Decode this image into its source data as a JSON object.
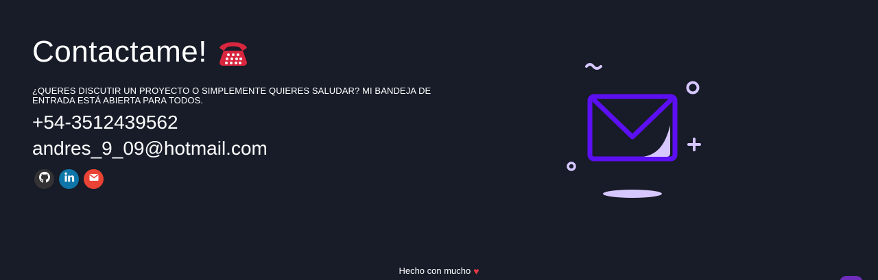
{
  "contact": {
    "title": "Contactame!",
    "title_icon": "telephone-icon",
    "subtitle": "¿QUERES DISCUTIR UN PROYECTO O SIMPLEMENTE QUIERES SALUDAR? MI BANDEJA DE ENTRADA ESTÁ ABIERTA PARA TODOS.",
    "phone": "+54-3512439562",
    "email": "andres_9_09@hotmail.com"
  },
  "socials": [
    {
      "name": "github-icon",
      "color": "#333333"
    },
    {
      "name": "linkedin-icon",
      "color": "#0e76a8"
    },
    {
      "name": "mail-icon",
      "color": "#ea4335"
    }
  ],
  "illustration": {
    "name": "envelope-illustration",
    "accent": "#5c0ff2",
    "light": "#d7c7ff"
  },
  "footer": {
    "text": "Hecho con mucho",
    "icon": "heart-icon"
  },
  "colors": {
    "background": "#171c28",
    "text": "#ffffff",
    "heart": "#e63946"
  }
}
